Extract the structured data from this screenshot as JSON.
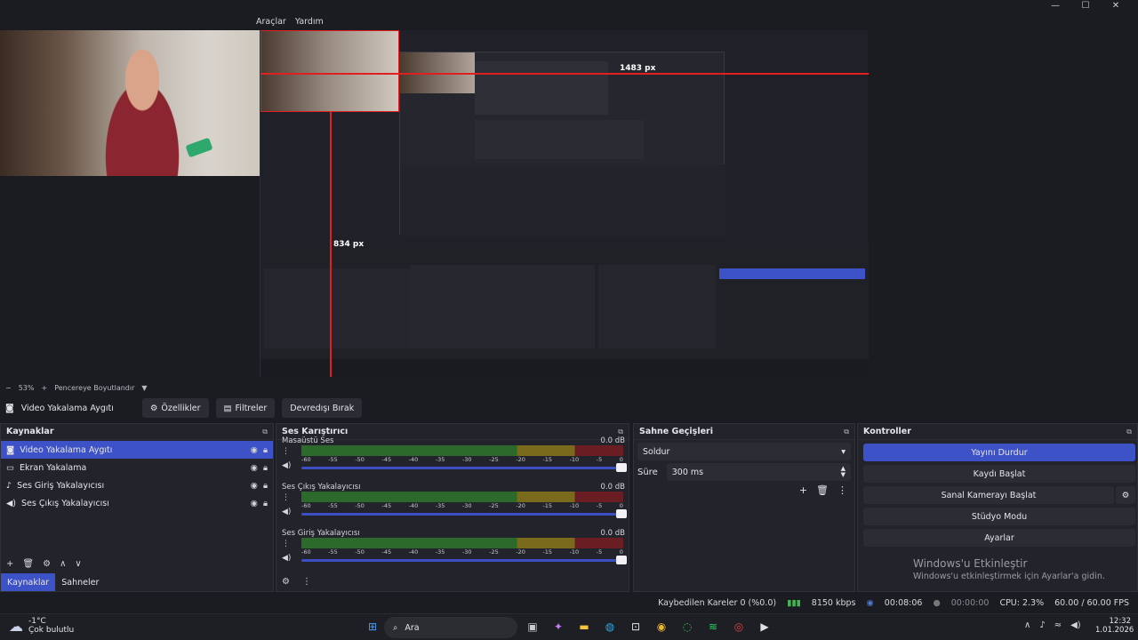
{
  "menu": {
    "items": [
      "Araçlar",
      "Yardım"
    ]
  },
  "window": {
    "minimize": "—",
    "maximize": "☐",
    "close": "✕"
  },
  "preview": {
    "label_width": "1483 px",
    "label_height": "834 px"
  },
  "zoombar": {
    "minus": "−",
    "zoom": "53%",
    "plus": "+",
    "fit": "Pencereye Boyutlandır",
    "arrow": "▼"
  },
  "source_toolbar": {
    "source_name": "Video Yakalama Aygıtı",
    "properties": "Özellikler",
    "filters": "Filtreler",
    "deactivate": "Devredışı Bırak"
  },
  "sources": {
    "title": "Kaynaklar",
    "items": [
      {
        "icon": "camera-icon",
        "label": "Video Yakalama Aygıtı"
      },
      {
        "icon": "monitor-icon",
        "label": "Ekran Yakalama"
      },
      {
        "icon": "microphone-icon",
        "label": "Ses Giriş Yakalayıcısı"
      },
      {
        "icon": "speaker-icon",
        "label": "Ses Çıkış Yakalayıcısı"
      }
    ],
    "tabs": [
      "Kaynaklar",
      "Sahneler"
    ]
  },
  "mixer": {
    "title": "Ses Karıştırıcı",
    "ticks": [
      "-60",
      "-55",
      "-50",
      "-45",
      "-40",
      "-35",
      "-30",
      "-25",
      "-20",
      "-15",
      "-10",
      "-5",
      "0"
    ],
    "channels": [
      {
        "name": "Masaüstü Ses",
        "db": "0.0 dB"
      },
      {
        "name": "Ses Çıkış Yakalayıcısı",
        "db": "0.0 dB"
      },
      {
        "name": "Ses Giriş Yakalayıcısı",
        "db": "0.0 dB"
      }
    ]
  },
  "transitions": {
    "title": "Sahne Geçişleri",
    "selected": "Soldur",
    "duration_label": "Süre",
    "duration_value": "300 ms"
  },
  "controls": {
    "title": "Kontroller",
    "stop_stream": "Yayını Durdur",
    "start_recording": "Kaydı Başlat",
    "start_virtual_cam": "Sanal Kamerayı Başlat",
    "studio_mode": "Stüdyo Modu",
    "settings": "Ayarlar",
    "activation_title": "Windows'u Etkinleştir",
    "activation_sub": "Windows'u etkinleştirmek için Ayarlar'a gidin."
  },
  "status": {
    "dropped": "Kaybedilen Kareler 0 (%0.0)",
    "bitrate": "8150 kbps",
    "stream_time": "00:08:06",
    "rec_time": "00:00:00",
    "cpu": "CPU: 2.3%",
    "fps": "60.00 / 60.00 FPS"
  },
  "taskbar": {
    "weather_temp": "-1°C",
    "weather_desc": "Çok bulutlu",
    "search_placeholder": "Ara",
    "time": "12:32",
    "date": "1.01.2026"
  },
  "colors": {
    "accent": "#3e52c8",
    "red": "#e02020"
  }
}
